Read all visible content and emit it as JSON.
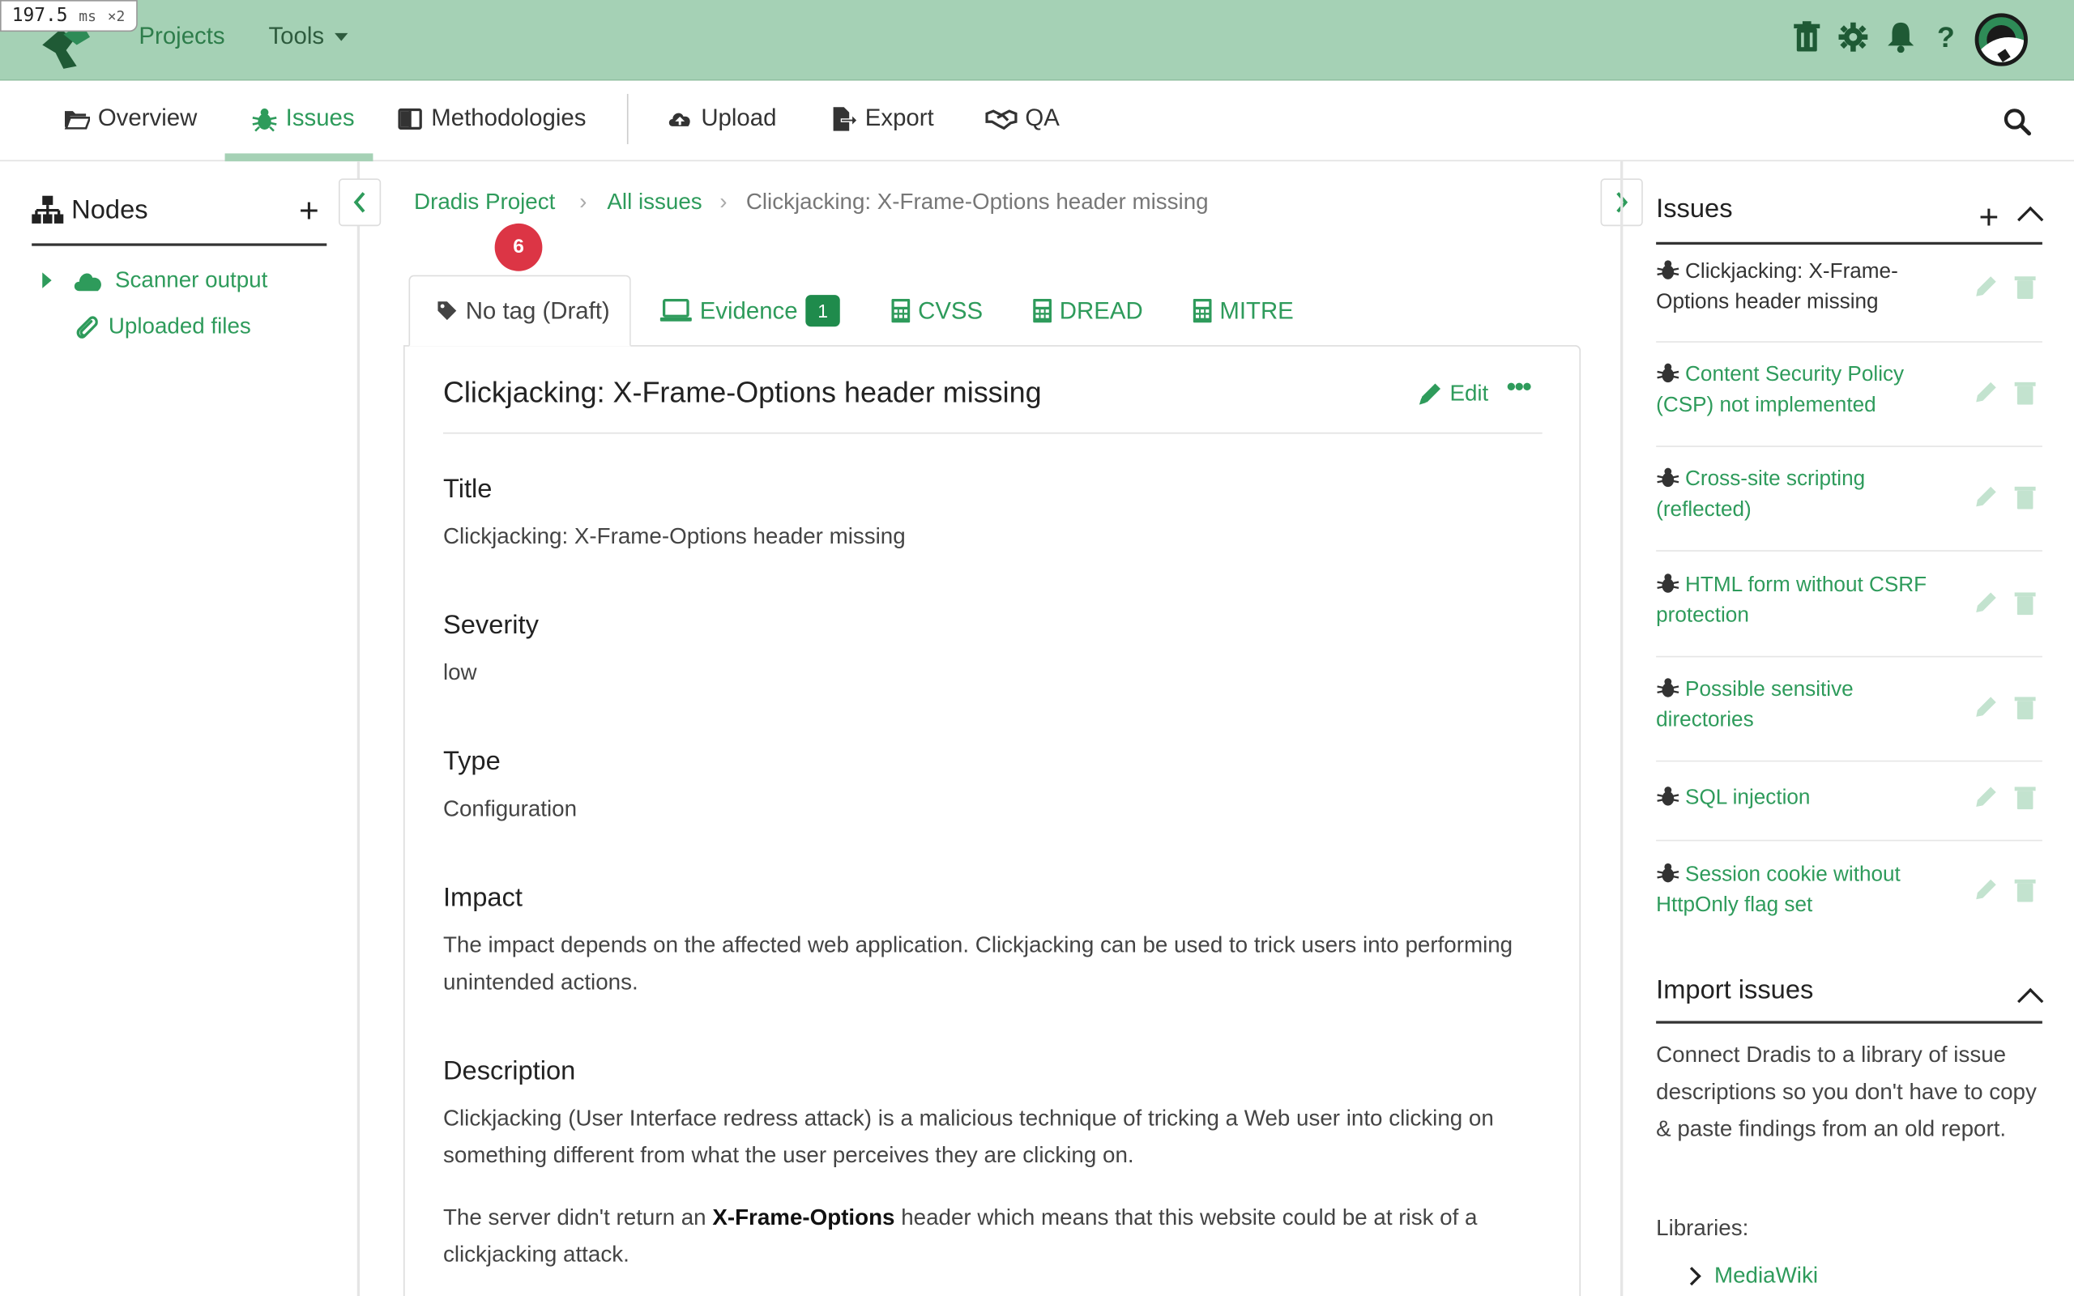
{
  "perf": {
    "value": "197.5",
    "unit": "ms",
    "mult": "×2"
  },
  "topbar": {
    "projects_label": "Projects",
    "tools_label": "Tools",
    "icons": [
      "trash-icon",
      "gear-icon",
      "bell-icon",
      "help-icon",
      "avatar"
    ]
  },
  "subnav": {
    "overview": "Overview",
    "issues": "Issues",
    "methodologies": "Methodologies",
    "upload": "Upload",
    "export": "Export",
    "qa": "QA"
  },
  "left": {
    "title": "Nodes",
    "items": [
      {
        "label": "Scanner output",
        "icon": "cloud-icon"
      },
      {
        "label": "Uploaded files",
        "icon": "paperclip-icon"
      }
    ]
  },
  "breadcrumb": {
    "project": "Dradis Project",
    "all_issues": "All issues",
    "current": "Clickjacking: X-Frame-Options header missing",
    "badge": "6"
  },
  "tabs": {
    "tag": "No tag (Draft)",
    "evidence": "Evidence",
    "evidence_count": "1",
    "cvss": "CVSS",
    "dread": "DREAD",
    "mitre": "MITRE"
  },
  "issue": {
    "title": "Clickjacking: X-Frame-Options header missing",
    "edit_label": "Edit",
    "more_label": "•••",
    "fields": {
      "title_label": "Title",
      "title_value": "Clickjacking: X-Frame-Options header missing",
      "severity_label": "Severity",
      "severity_value": "low",
      "type_label": "Type",
      "type_value": "Configuration",
      "impact_label": "Impact",
      "impact_value": "The impact depends on the affected web application. Clickjacking can be used to trick users into performing unintended actions.",
      "description_label": "Description",
      "description_p1": "Clickjacking (User Interface redress attack) is a malicious technique of tricking a Web user into clicking on something different from what the user perceives they are clicking on.",
      "description_p2_a": "The server didn't return an ",
      "description_p2_b": "X-Frame-Options",
      "description_p2_c": " header which means that this website could be at risk of a clickjacking attack."
    }
  },
  "right": {
    "issues_title": "Issues",
    "issues": [
      {
        "label": "Clickjacking: X-Frame-Options header missing",
        "selected": true
      },
      {
        "label": "Content Security Policy (CSP) not implemented",
        "selected": false
      },
      {
        "label": "Cross-site scripting (reflected)",
        "selected": false
      },
      {
        "label": "HTML form without CSRF protection",
        "selected": false
      },
      {
        "label": "Possible sensitive directories",
        "selected": false
      },
      {
        "label": "SQL injection",
        "selected": false
      },
      {
        "label": "Session cookie without HttpOnly flag set",
        "selected": false
      }
    ],
    "import_title": "Import issues",
    "import_text": "Connect Dradis to a library of issue descriptions so you don't have to copy & paste findings from an old report.",
    "libraries_label": "Libraries:",
    "library_item": "MediaWiki"
  }
}
